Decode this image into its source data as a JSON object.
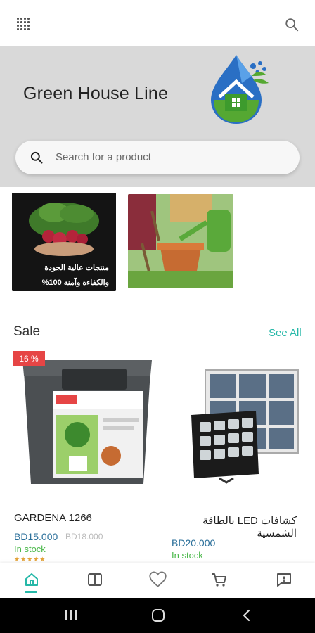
{
  "app": {
    "brand_title": "Green House Line"
  },
  "search": {
    "placeholder": "Search for a product"
  },
  "banners": [
    {
      "line1": "منتجات عالية الجودة",
      "line2": "والكفاءة وآمنة 100%"
    },
    {}
  ],
  "sale": {
    "title": "Sale",
    "see_all": "See All"
  },
  "products": [
    {
      "discount": "16 %",
      "name": "GARDENA 1266",
      "price": "BD15.000",
      "old_price": "BD18.000",
      "stock": "In stock",
      "rating_stars": "★★★★★"
    },
    {
      "name": "كشافات LED بالطاقة الشمسية",
      "price": "BD20.000",
      "stock": "In stock"
    }
  ],
  "icons": {
    "menu": "grid-icon",
    "search": "search-icon",
    "home": "home-icon",
    "catalog": "book-icon",
    "wishlist": "heart-icon",
    "cart": "cart-icon",
    "messages": "message-icon"
  },
  "colors": {
    "accent": "#26b8a8",
    "price": "#2a6f9a",
    "stock": "#4ab84a",
    "discount": "#e64545"
  }
}
